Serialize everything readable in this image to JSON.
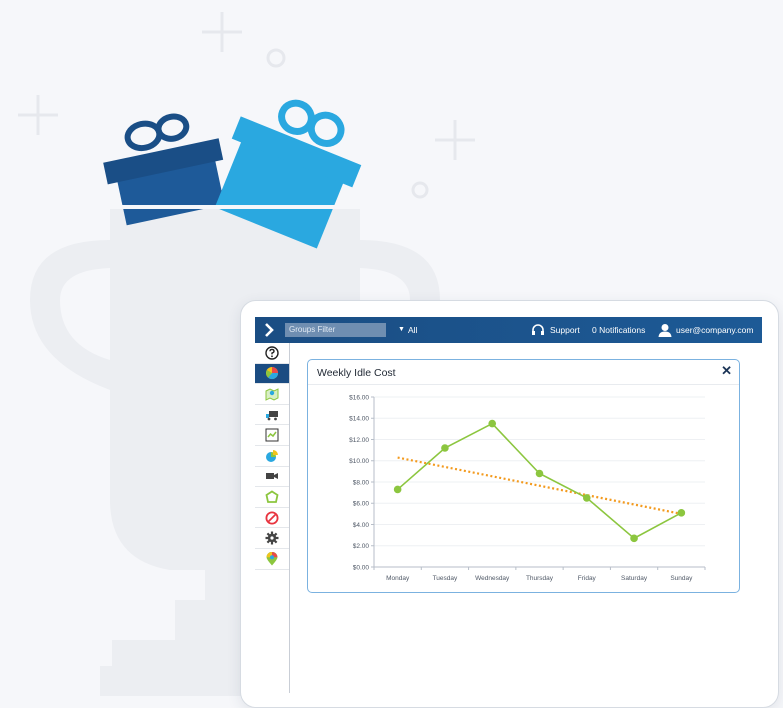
{
  "topbar": {
    "groups_filter_placeholder": "Groups Filter",
    "filter_value": "All",
    "support_label": "Support",
    "notifications_label": "0 Notifications",
    "user_email": "user@company.com"
  },
  "colors": {
    "topbar": "#1a4d83",
    "accent_blue": "#2aa8e0",
    "dark_blue": "#1b5a96",
    "line_green": "#8cc63f",
    "trend_orange": "#f39a1e"
  },
  "sidebar": {
    "items": [
      {
        "icon": "help-icon"
      },
      {
        "icon": "pie-chart-icon",
        "active": true
      },
      {
        "icon": "map-icon"
      },
      {
        "icon": "truck-icon"
      },
      {
        "icon": "line-chart-icon"
      },
      {
        "icon": "pie-slice-icon"
      },
      {
        "icon": "camera-icon"
      },
      {
        "icon": "geofence-icon"
      },
      {
        "icon": "blocked-icon"
      },
      {
        "icon": "settings-icon"
      },
      {
        "icon": "location-pin-icon"
      }
    ]
  },
  "panel": {
    "title": "Weekly Idle Cost",
    "close_symbol": "✕"
  },
  "chart_data": {
    "type": "line",
    "title": "Weekly Idle Cost",
    "categories": [
      "Monday",
      "Tuesday",
      "Wednesday",
      "Thursday",
      "Friday",
      "Saturday",
      "Sunday"
    ],
    "series": [
      {
        "values": [
          7.3,
          11.2,
          13.5,
          8.8,
          6.5,
          2.7,
          5.1
        ]
      }
    ],
    "trendline": {
      "style": "dotted",
      "start": 10.3,
      "end": 5.0
    },
    "y_ticks": [
      "$0.00",
      "$2.00",
      "$4.00",
      "$6.00",
      "$8.00",
      "$10.00",
      "$12.00",
      "$14.00",
      "$16.00"
    ],
    "ylim": [
      0,
      16
    ],
    "grid": true
  }
}
